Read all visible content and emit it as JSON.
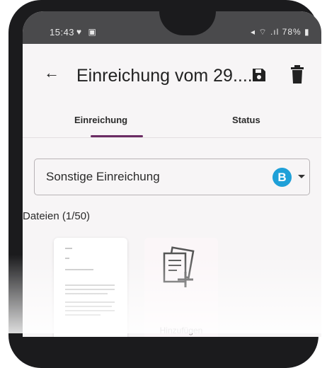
{
  "status_bar": {
    "time": "15:43",
    "left_icons": "♥ ▣",
    "battery": "78%"
  },
  "app_bar": {
    "title": "Einreichung vom 29....",
    "back_icon": "arrow-left-icon",
    "save_icon": "save-icon",
    "delete_icon": "trash-icon"
  },
  "tabs": [
    {
      "label": "Einreichung",
      "active": true
    },
    {
      "label": "Status",
      "active": false
    }
  ],
  "type_select": {
    "value": "Sonstige Einreichung",
    "badge": "B"
  },
  "files": {
    "label": "Dateien (1/50)",
    "add_label": "Hinzufügen"
  },
  "colors": {
    "accent": "#6b2b63",
    "badge": "#1fa0d8"
  }
}
